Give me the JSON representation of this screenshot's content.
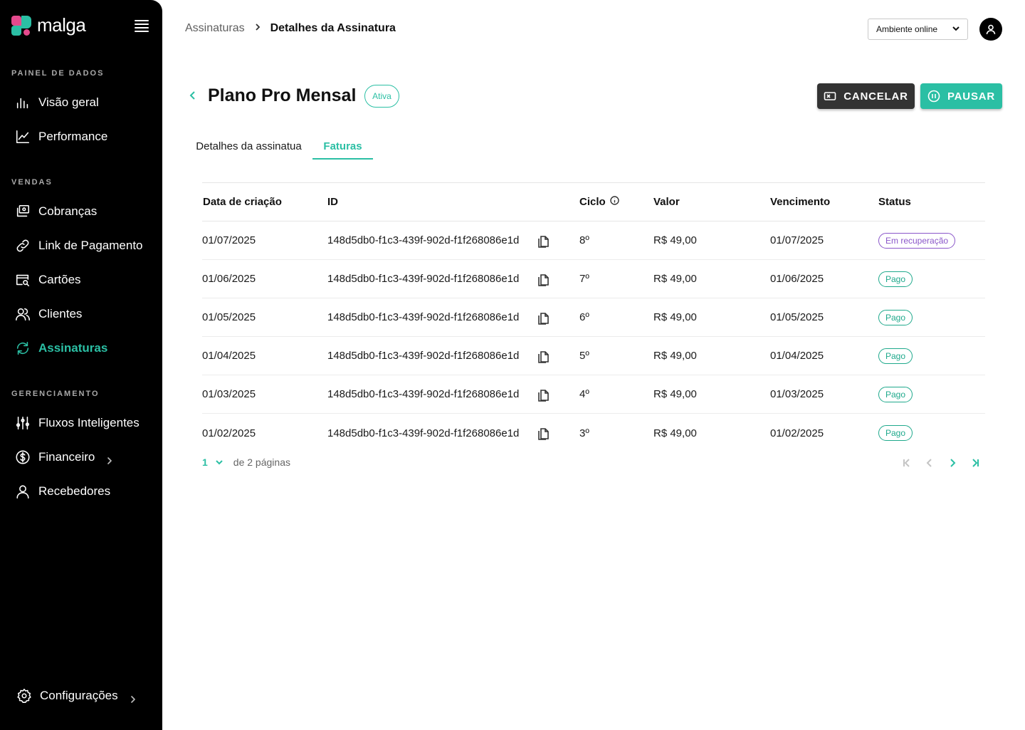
{
  "brand": {
    "name": "malga",
    "accent": "#2bbfa4",
    "pink": "#e44a8d"
  },
  "sidebar": {
    "sections": [
      {
        "label": "PAINEL DE DADOS"
      },
      {
        "label": "VENDAS"
      },
      {
        "label": "GERENCIAMENTO"
      }
    ],
    "items": [
      {
        "label": "Visão geral",
        "icon": "bar-chart-icon"
      },
      {
        "label": "Performance",
        "icon": "line-chart-icon"
      },
      {
        "label": "Cobranças",
        "icon": "charges-icon"
      },
      {
        "label": "Link de Pagamento",
        "icon": "link-icon"
      },
      {
        "label": "Cartões",
        "icon": "card-search-icon"
      },
      {
        "label": "Clientes",
        "icon": "users-icon"
      },
      {
        "label": "Assinaturas",
        "icon": "refresh-icon",
        "active": true
      },
      {
        "label": "Fluxos Inteligentes",
        "icon": "sliders-icon"
      },
      {
        "label": "Financeiro",
        "icon": "dollar-circle-icon"
      },
      {
        "label": "Recebedores",
        "icon": "user-icon"
      },
      {
        "label": "Configurações",
        "icon": "gear-icon"
      }
    ]
  },
  "header": {
    "breadcrumb": {
      "parent": "Assinaturas",
      "current": "Detalhes da Assinatura"
    },
    "environment": "Ambiente online"
  },
  "subscription": {
    "title": "Plano Pro Mensal",
    "status": "Ativa",
    "cancel_label": "CANCELAR",
    "pause_label": "PAUSAR"
  },
  "tabs": [
    {
      "label": "Detalhes da assinatua"
    },
    {
      "label": "Faturas",
      "active": true
    }
  ],
  "table": {
    "columns": [
      "Data de criação",
      "ID",
      "Ciclo",
      "Valor",
      "Vencimento",
      "Status"
    ],
    "rows": [
      {
        "created": "01/07/2025",
        "id": "148d5db0-f1c3-439f-902d-f1f268086e1d",
        "cycle": "8º",
        "amount": "R$ 49,00",
        "due": "01/07/2025",
        "status": "Em recuperação",
        "status_kind": "recovery"
      },
      {
        "created": "01/06/2025",
        "id": "148d5db0-f1c3-439f-902d-f1f268086e1d",
        "cycle": "7º",
        "amount": "R$ 49,00",
        "due": "01/06/2025",
        "status": "Pago",
        "status_kind": "paid"
      },
      {
        "created": "01/05/2025",
        "id": "148d5db0-f1c3-439f-902d-f1f268086e1d",
        "cycle": "6º",
        "amount": "R$ 49,00",
        "due": "01/05/2025",
        "status": "Pago",
        "status_kind": "paid"
      },
      {
        "created": "01/04/2025",
        "id": "148d5db0-f1c3-439f-902d-f1f268086e1d",
        "cycle": "5º",
        "amount": "R$ 49,00",
        "due": "01/04/2025",
        "status": "Pago",
        "status_kind": "paid"
      },
      {
        "created": "01/03/2025",
        "id": "148d5db0-f1c3-439f-902d-f1f268086e1d",
        "cycle": "4º",
        "amount": "R$ 49,00",
        "due": "01/03/2025",
        "status": "Pago",
        "status_kind": "paid"
      },
      {
        "created": "01/02/2025",
        "id": "148d5db0-f1c3-439f-902d-f1f268086e1d",
        "cycle": "3º",
        "amount": "R$ 49,00",
        "due": "01/02/2025",
        "status": "Pago",
        "status_kind": "paid"
      }
    ]
  },
  "pagination": {
    "current": "1",
    "of_label": "de 2 páginas"
  }
}
